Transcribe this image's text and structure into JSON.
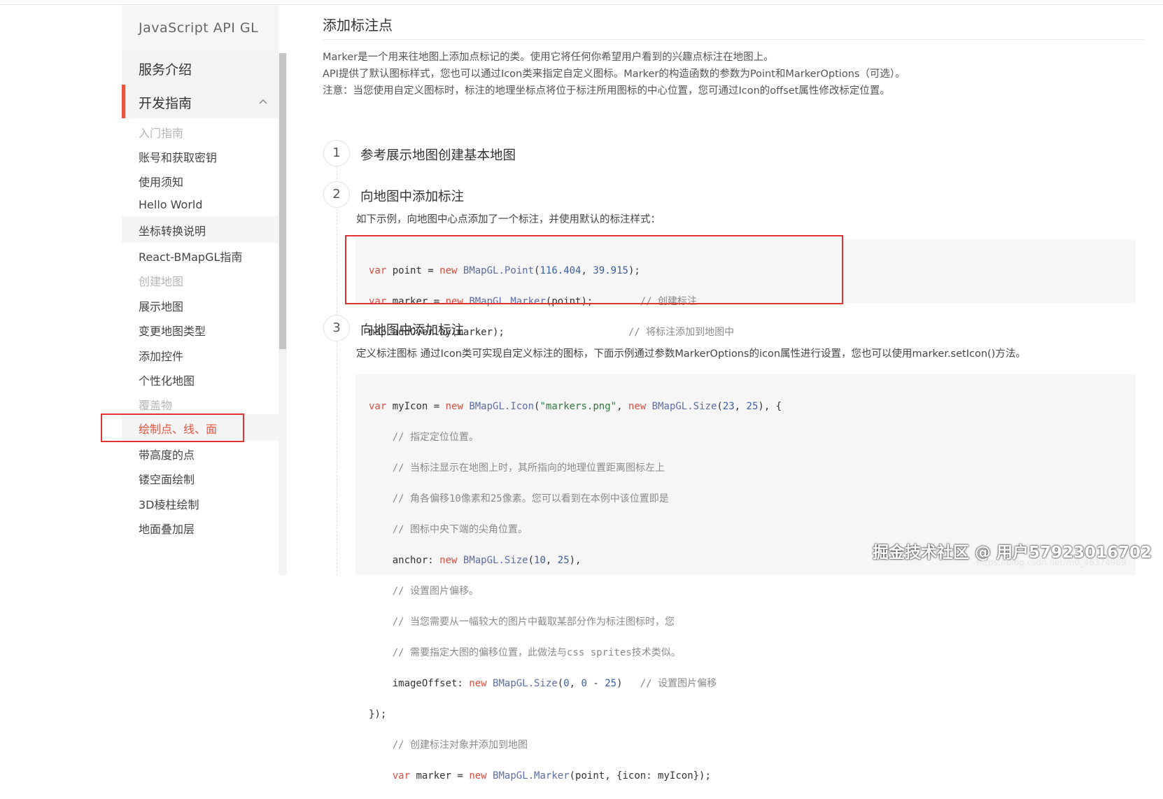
{
  "sidebar": {
    "title": "JavaScript API GL",
    "sections": [
      {
        "label": "服务介绍"
      },
      {
        "label": "开发指南"
      }
    ],
    "items": [
      {
        "label": "入门指南",
        "group": true
      },
      {
        "label": "账号和获取密钥"
      },
      {
        "label": "使用须知"
      },
      {
        "label": "Hello World"
      },
      {
        "label": "坐标转换说明"
      },
      {
        "label": "React-BMapGL指南"
      },
      {
        "label": "创建地图",
        "group": true
      },
      {
        "label": "展示地图"
      },
      {
        "label": "变更地图类型"
      },
      {
        "label": "添加控件"
      },
      {
        "label": "个性化地图"
      },
      {
        "label": "覆盖物",
        "group": true
      },
      {
        "label": "绘制点、线、面",
        "current": true
      },
      {
        "label": "带高度的点"
      },
      {
        "label": "镂空面绘制"
      },
      {
        "label": "3D棱柱绘制"
      },
      {
        "label": "地面叠加层"
      }
    ]
  },
  "main": {
    "title": "添加标注点",
    "intro": [
      "Marker是一个用来往地图上添加点标记的类。使用它将任何你希望用户看到的兴趣点标注在地图上。",
      "API提供了默认图标样式，您也可以通过Icon类来指定自定义图标。Marker的构造函数的参数为Point和MarkerOptions（可选）。",
      "注意：当您使用自定义图标时，标注的地理坐标点将位于标注所用图标的中心位置，您可通过Icon的offset属性修改标定位置。"
    ],
    "steps": [
      {
        "num": "1",
        "title": "参考展示地图创建基本地图"
      },
      {
        "num": "2",
        "title": "向地图中添加标注",
        "desc": "如下示例，向地图中心点添加了一个标注，并使用默认的标注样式："
      },
      {
        "num": "3",
        "title": "向地图中添加标注",
        "desc": "定义标注图标 通过Icon类可实现自定义标注的图标，下面示例通过参数MarkerOptions的icon属性进行设置，您也可以使用marker.setIcon()方法。"
      }
    ],
    "code1": [
      "var point = new BMapGL.Point(116.404, 39.915);",
      "var marker = new BMapGL.Marker(point);        // 创建标注",
      "map.addOverlay(marker);                     // 将标注添加到地图中"
    ],
    "code2": [
      "var myIcon = new BMapGL.Icon(\"markers.png\", new BMapGL.Size(23, 25), {",
      "    // 指定定位位置。",
      "    // 当标注显示在地图上时，其所指向的地理位置距离图标左上",
      "    // 角各偏移10像素和25像素。您可以看到在本例中该位置即是",
      "    // 图标中央下端的尖角位置。",
      "    anchor: new BMapGL.Size(10, 25),",
      "    // 设置图片偏移。",
      "    // 当您需要从一幅较大的图片中截取某部分作为标注图标时，您",
      "    // 需要指定大图的偏移位置，此做法与css sprites技术类似。",
      "    imageOffset: new BMapGL.Size(0, 0 - 25)   // 设置图片偏移",
      "});",
      "    // 创建标注对象并添加到地图",
      "    var marker = new BMapGL.Marker(point, {icon: myIcon});"
    ]
  },
  "watermark": {
    "text": "掘金技术社区 @ 用户57923016702",
    "sub": "https://blog.csdn.net/m0_46374969"
  },
  "colors": {
    "accent": "#e8533d",
    "highlight_box": "#e03333"
  }
}
